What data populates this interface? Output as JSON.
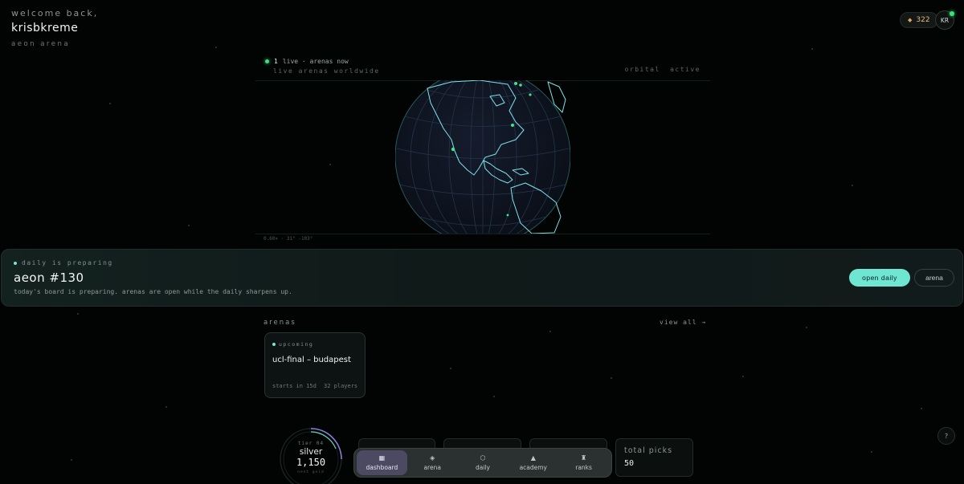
{
  "header": {
    "welcome": "welcome back,",
    "username": "krisbkreme",
    "brand": "aeon arena",
    "coins": "322",
    "coin_icon": "diamond-icon",
    "avatar_initials": "KR"
  },
  "globe": {
    "live_count": "1",
    "live_text": "live · arenas now",
    "subtitle": "live arenas worldwide",
    "status": "orbital active",
    "coords": "0.60× · 31° -103°"
  },
  "daily": {
    "status": "daily is preparing",
    "title": "aeon #130",
    "description": "today's board is preparing. arenas are open while the daily sharpens up.",
    "open_button": "open daily",
    "arena_button": "arena"
  },
  "arenas": {
    "heading": "arenas",
    "view_all": "view all →",
    "cards": [
      {
        "status": "upcoming",
        "title": "ucl-final – budapest",
        "starts": "starts in 15d",
        "players": "32 players"
      }
    ]
  },
  "tier": {
    "label": "tier 04",
    "name": "silver",
    "score": "1,150",
    "sub": "next gold"
  },
  "stats": {
    "total_picks_label": "total picks",
    "total_picks_value": "50"
  },
  "nav": {
    "items": [
      {
        "label": "dashboard",
        "icon": "grid-icon"
      },
      {
        "label": "arena",
        "icon": "cube-icon"
      },
      {
        "label": "daily",
        "icon": "hexagon-icon"
      },
      {
        "label": "academy",
        "icon": "graduation-cap-icon"
      },
      {
        "label": "ranks",
        "icon": "trophy-icon"
      }
    ]
  },
  "help_label": "?",
  "colors": {
    "accent": "#6fe6d2",
    "live": "#3de07e",
    "background": "#020403",
    "coin": "#e0b97a"
  }
}
